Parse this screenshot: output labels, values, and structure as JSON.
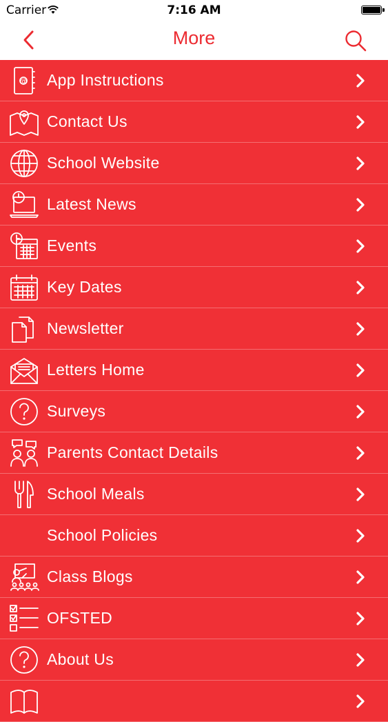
{
  "status_bar": {
    "carrier": "Carrier",
    "time": "7:16 AM"
  },
  "nav": {
    "title": "More",
    "back_icon": "chevron-left-icon",
    "search_icon": "search-icon"
  },
  "accent_color": "#ec2b31",
  "list_background": "#f03036",
  "menu": [
    {
      "label": "App Instructions",
      "icon": "address-book-icon"
    },
    {
      "label": "Contact Us",
      "icon": "map-pin-icon"
    },
    {
      "label": "School Website",
      "icon": "globe-icon"
    },
    {
      "label": "Latest News",
      "icon": "laptop-clock-icon"
    },
    {
      "label": "Events",
      "icon": "calendar-clock-icon"
    },
    {
      "label": "Key Dates",
      "icon": "calendar-icon"
    },
    {
      "label": "Newsletter",
      "icon": "documents-icon"
    },
    {
      "label": "Letters Home",
      "icon": "envelope-icon"
    },
    {
      "label": "Surveys",
      "icon": "question-icon"
    },
    {
      "label": "Parents Contact Details",
      "icon": "people-chat-icon"
    },
    {
      "label": "School Meals",
      "icon": "fork-knife-icon"
    },
    {
      "label": "School Policies",
      "icon": ""
    },
    {
      "label": "Class Blogs",
      "icon": "classroom-icon"
    },
    {
      "label": "OFSTED",
      "icon": "checklist-icon"
    },
    {
      "label": "About Us",
      "icon": "question-icon"
    },
    {
      "label": "",
      "icon": "book-icon"
    }
  ]
}
